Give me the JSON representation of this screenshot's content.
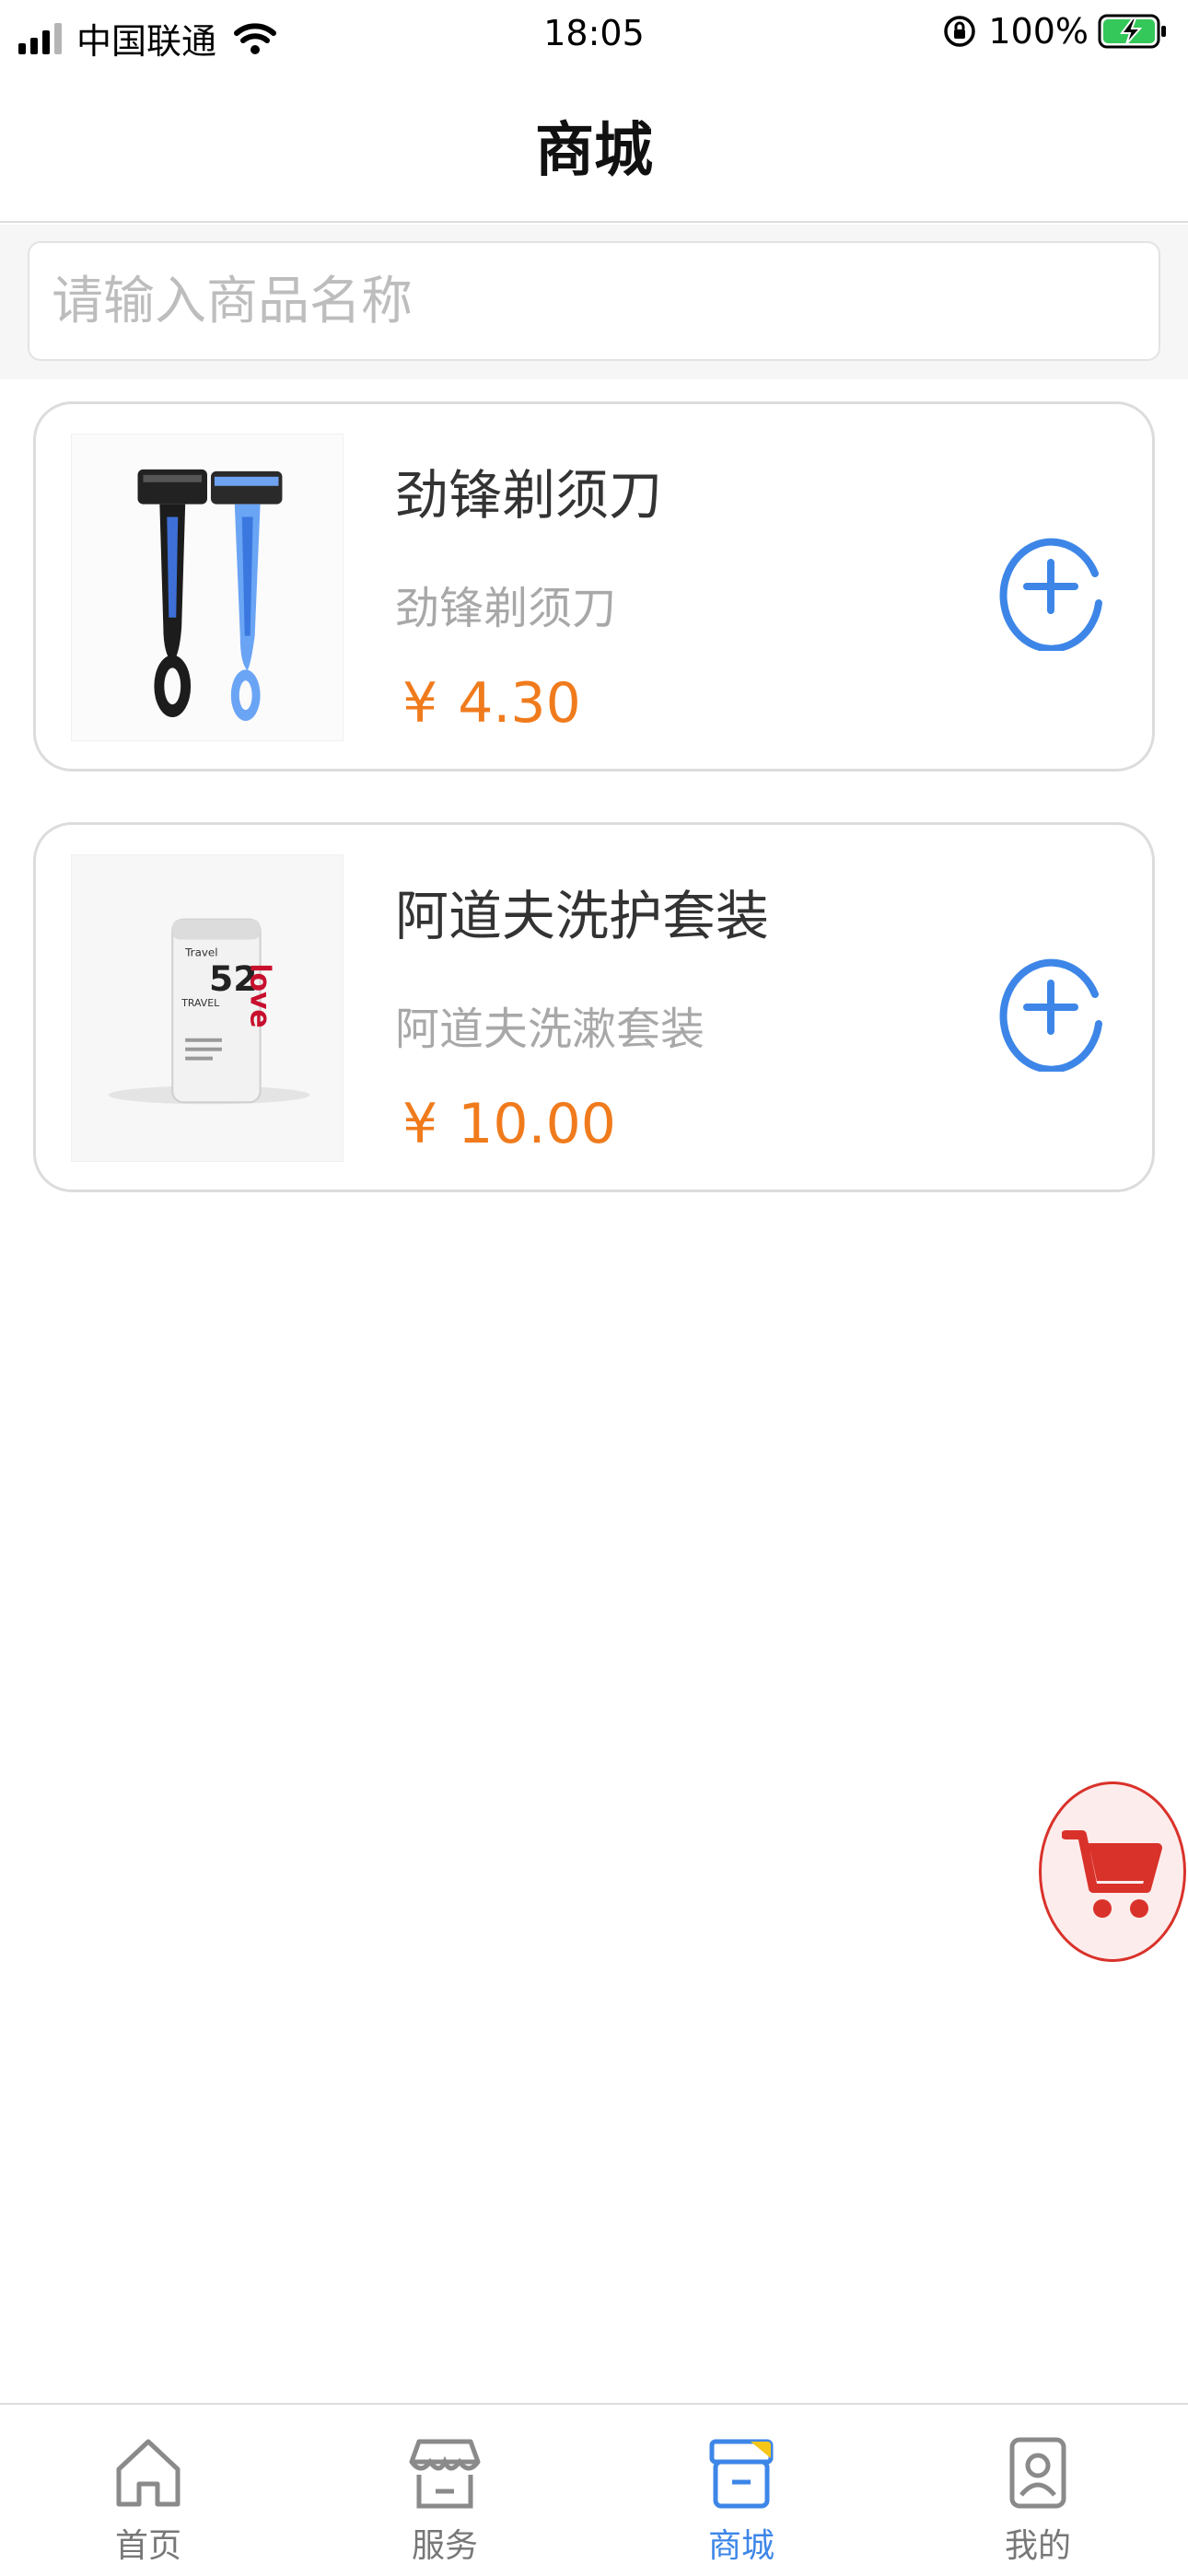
{
  "status_bar": {
    "carrier": "中国联通",
    "time": "18:05",
    "battery": "100%"
  },
  "nav": {
    "title": "商城"
  },
  "search": {
    "placeholder": "请输入商品名称",
    "value": ""
  },
  "products": [
    {
      "name": "劲锋剃须刀",
      "desc": "劲锋剃须刀",
      "currency": "¥",
      "price": "4.30",
      "image_icon": "razor-image"
    },
    {
      "name": "阿道夫洗护套装",
      "desc": "阿道夫洗漱套装",
      "currency": "¥",
      "price": "10.00",
      "image_icon": "travel-kit-image"
    }
  ],
  "tabs": [
    {
      "label": "首页",
      "icon": "home-icon"
    },
    {
      "label": "服务",
      "icon": "store-icon"
    },
    {
      "label": "商城",
      "icon": "mall-box-icon",
      "active": true
    },
    {
      "label": "我的",
      "icon": "profile-icon"
    }
  ],
  "colors": {
    "accent_blue": "#3d86e8",
    "price_orange": "#f07b1d",
    "cart_red": "#d9322a"
  }
}
